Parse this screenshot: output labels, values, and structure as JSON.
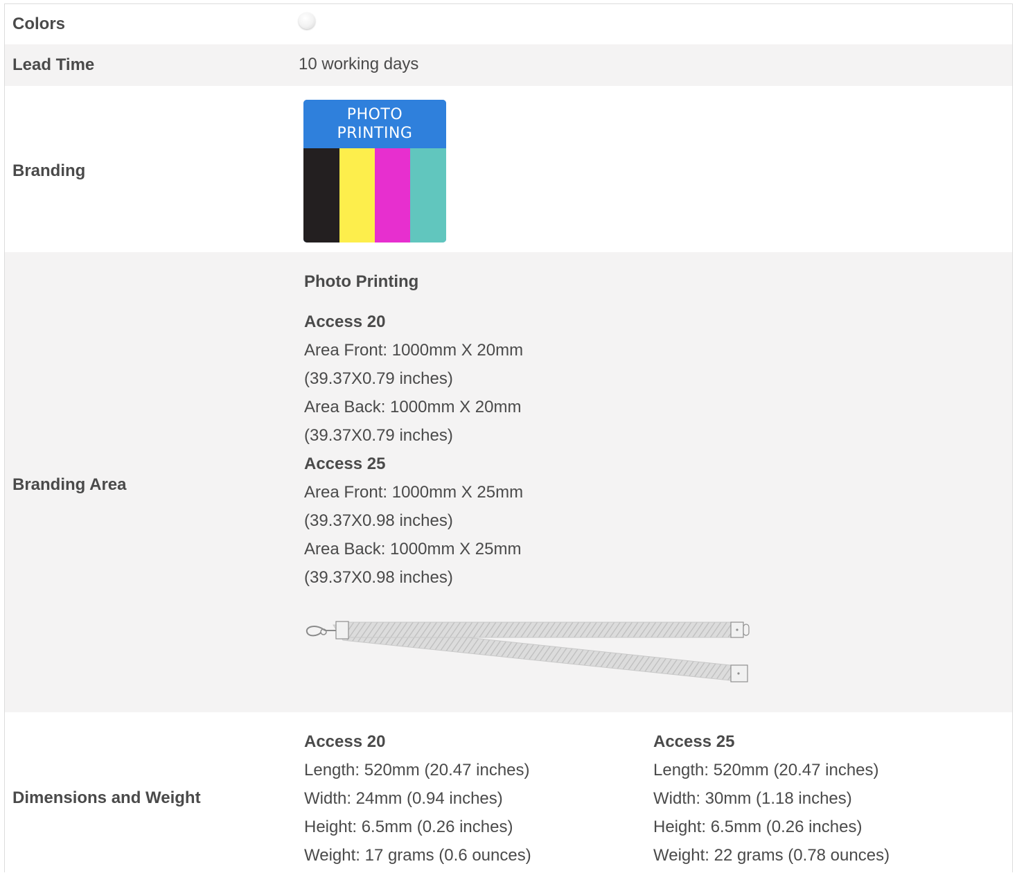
{
  "rows": {
    "colors": {
      "label": "Colors",
      "swatches": [
        {
          "color": "#ffffff",
          "name": "white"
        }
      ]
    },
    "lead_time": {
      "label": "Lead Time",
      "value": "10 working days"
    },
    "branding": {
      "label": "Branding",
      "badge": {
        "line1": "PHOTO",
        "line2": "PRINTING",
        "colors": [
          "#2f80dc",
          "#231f20",
          "#fdee4c",
          "#e72fcf",
          "#61c6be"
        ]
      }
    },
    "branding_area": {
      "label": "Branding Area",
      "method": "Photo Printing",
      "models": [
        {
          "name": "Access 20",
          "lines": [
            "Area Front: 1000mm X 20mm",
            "(39.37X0.79 inches)",
            "Area Back: 1000mm X 20mm",
            "(39.37X0.79 inches)"
          ]
        },
        {
          "name": "Access 25",
          "lines": [
            "Area Front: 1000mm X 25mm",
            "(39.37X0.98 inches)",
            "Area Back: 1000mm X 25mm",
            "(39.37X0.98 inches)"
          ]
        }
      ]
    },
    "dimensions": {
      "label": "Dimensions and Weight",
      "models": [
        {
          "name": "Access 20",
          "length": "Length: 520mm (20.47 inches)",
          "width": "Width: 24mm (0.94 inches)",
          "height": "Height: 6.5mm (0.26 inches)",
          "weight": "Weight: 17 grams (0.6 ounces)"
        },
        {
          "name": "Access 25",
          "length": "Length: 520mm (20.47 inches)",
          "width": "Width: 30mm (1.18 inches)",
          "height": "Height: 6.5mm (0.26 inches)",
          "weight": "Weight: 22 grams (0.78 ounces)"
        }
      ]
    }
  }
}
